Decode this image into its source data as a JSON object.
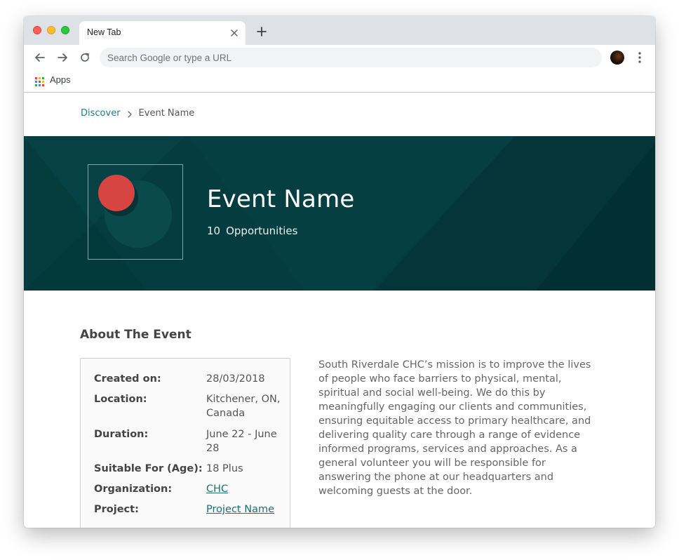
{
  "browser": {
    "tab_title": "New Tab",
    "omnibox_placeholder": "Search Google or type a URL",
    "bookmarks": {
      "apps_label": "Apps"
    }
  },
  "breadcrumb": {
    "link": "Discover",
    "current": "Event Name"
  },
  "hero": {
    "title": "Event Name",
    "opportunities_count": "10",
    "opportunities_label": "Opportunities",
    "colors": {
      "background": "#053c3f",
      "logo_red": "#d64541",
      "logo_teal": "#0a4a4d"
    }
  },
  "about": {
    "heading": "About The Event",
    "details": [
      {
        "label": "Created on:",
        "value": "28/03/2018"
      },
      {
        "label": "Location:",
        "value": "Kitchener, ON, Canada"
      },
      {
        "label": "Duration:",
        "value": "June 22 - June 28"
      },
      {
        "label": "Suitable For (Age):",
        "value": "18 Plus"
      },
      {
        "label": "Organization:",
        "value": "CHC"
      },
      {
        "label": "Project:",
        "value": "Project Name"
      }
    ],
    "description": "South Riverdale CHC’s mission is to improve the lives of people who face barriers to physical, mental, spiritual and social well-being. We do this by meaningfully engaging our clients and communities, ensuring equitable access to primary healthcare, and delivering quality care through a range of evidence informed programs, services and approaches. As a general volunteer you will be responsible for answering the phone at our headquarters and welcoming guests at the door."
  }
}
